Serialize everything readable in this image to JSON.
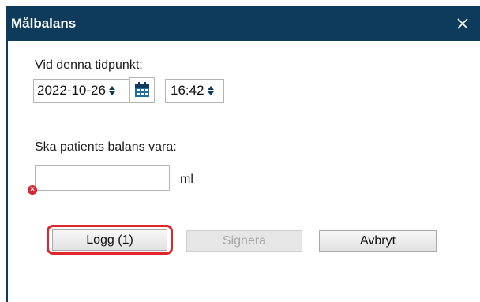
{
  "dialog": {
    "title": "Målbalans",
    "close_icon": "close-icon"
  },
  "timepoint": {
    "label": "Vid denna tidpunkt:",
    "date": "2022-10-26",
    "time": "16:42",
    "calendar_icon": "calendar-icon"
  },
  "balance": {
    "label": "Ska patients balans vara:",
    "value": "",
    "unit": "ml",
    "error_icon": "error-icon"
  },
  "buttons": {
    "log": "Logg (1)",
    "sign": "Signera",
    "cancel": "Avbryt"
  },
  "colors": {
    "titlebar": "#0e3b5c",
    "highlight": "#e0252b",
    "error": "#d6262f"
  }
}
